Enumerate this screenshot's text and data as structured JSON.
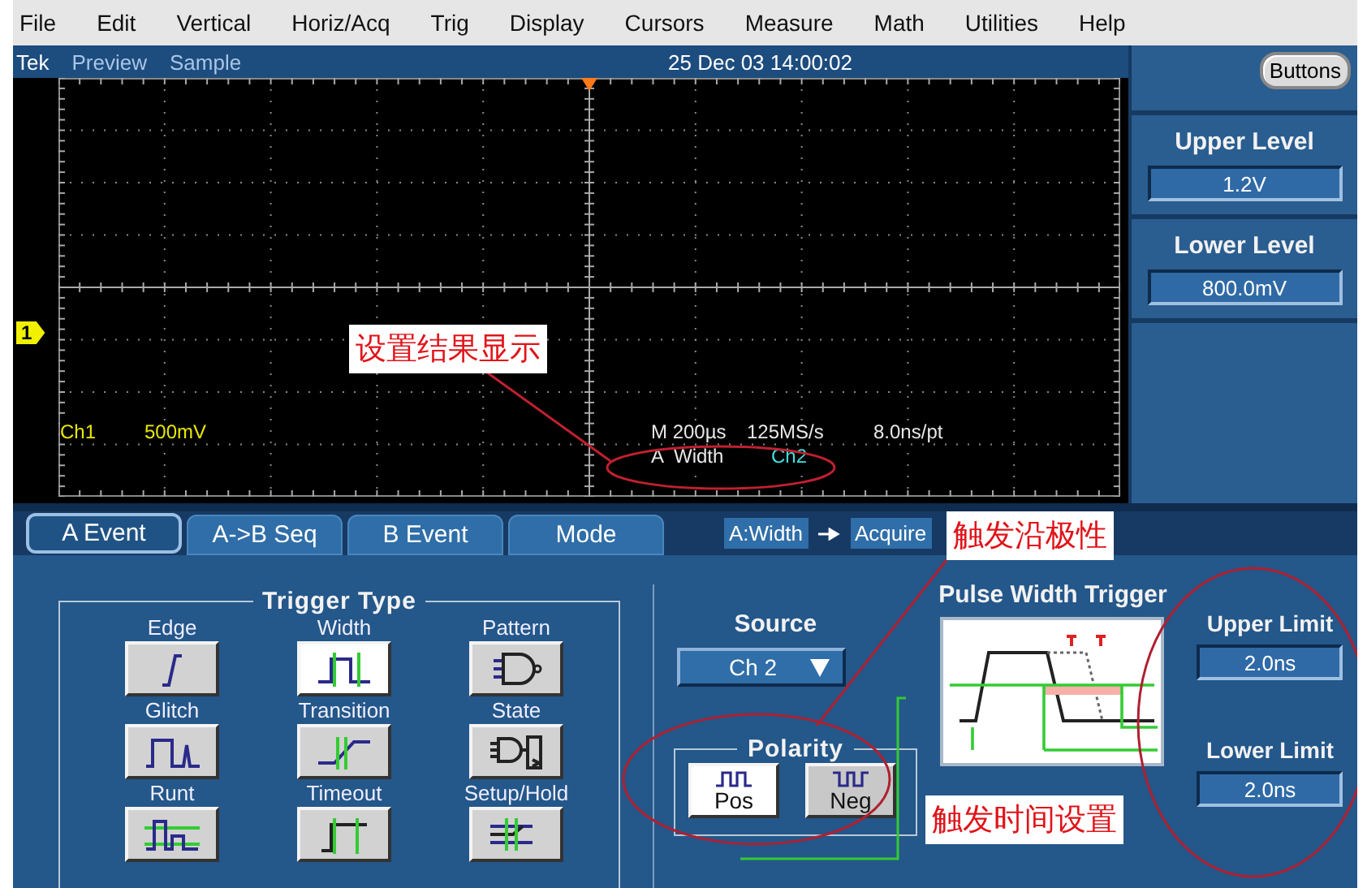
{
  "menu_bar": [
    "File",
    "Edit",
    "Vertical",
    "Horiz/Acq",
    "Trig",
    "Display",
    "Cursors",
    "Measure",
    "Math",
    "Utilities",
    "Help"
  ],
  "status_bar": {
    "brand": "Tek",
    "mode": "Preview",
    "acquisition": "Sample",
    "datetime": "25 Dec 03 14:00:02"
  },
  "side_panel": {
    "button": "Buttons",
    "levels": [
      {
        "label": "Upper Level",
        "value": "1.2V"
      },
      {
        "label": "Lower Level",
        "value": "800.0mV"
      }
    ]
  },
  "scope": {
    "channel_marker": "1",
    "readouts": {
      "channel": "Ch1",
      "scale": "500mV",
      "timebase": "M 200µs",
      "sample_rate": "125MS/s",
      "resolution": "8.0ns/pt",
      "trigger_type": "A  Width",
      "trigger_source": "Ch2"
    }
  },
  "tabs": [
    {
      "label": "A Event",
      "selected": true
    },
    {
      "label": "A->B Seq",
      "selected": false
    },
    {
      "label": "B Event",
      "selected": false
    },
    {
      "label": "Mode",
      "selected": false
    }
  ],
  "breadcrumb": {
    "type": "A:Width",
    "target": "Acquire"
  },
  "trigger_type": {
    "title": "Trigger Type",
    "options": [
      {
        "label": "Edge",
        "kind": "edge",
        "selected": false
      },
      {
        "label": "Width",
        "kind": "width",
        "selected": true
      },
      {
        "label": "Pattern",
        "kind": "pattern",
        "selected": false
      },
      {
        "label": "Glitch",
        "kind": "glitch",
        "selected": false
      },
      {
        "label": "Transition",
        "kind": "transition",
        "selected": false
      },
      {
        "label": "State",
        "kind": "state",
        "selected": false
      },
      {
        "label": "Runt",
        "kind": "runt",
        "selected": false
      },
      {
        "label": "Timeout",
        "kind": "timeout",
        "selected": false
      },
      {
        "label": "Setup/Hold",
        "kind": "setup_hold",
        "selected": false
      }
    ]
  },
  "source": {
    "label": "Source",
    "value": "Ch 2"
  },
  "polarity": {
    "title": "Polarity",
    "options": [
      {
        "label": "Pos",
        "kind": "pos",
        "selected": true
      },
      {
        "label": "Neg",
        "kind": "neg",
        "selected": false
      }
    ]
  },
  "pulse_width": {
    "title": "Pulse Width Trigger",
    "limits": [
      {
        "label": "Upper Limit",
        "value": "2.0ns"
      },
      {
        "label": "Lower Limit",
        "value": "2.0ns"
      }
    ]
  },
  "annotations": [
    {
      "text": "设置结果显示",
      "kind": "result"
    },
    {
      "text": "触发沿极性",
      "kind": "polarity"
    },
    {
      "text": "触发时间设置",
      "kind": "time"
    }
  ]
}
